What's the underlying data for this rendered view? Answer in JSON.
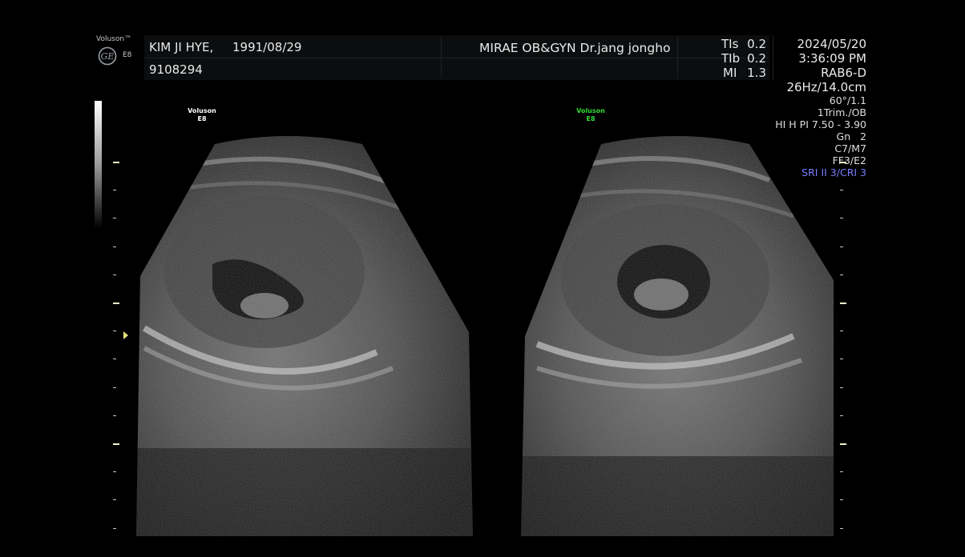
{
  "device": {
    "brand": "Voluson™",
    "model": "E8",
    "logo": "GE"
  },
  "patient": {
    "name": "KIM JI HYE,",
    "dob": "1991/08/29",
    "id": "9108294"
  },
  "clinic": "MIRAE OB&GYN Dr.jang jongho",
  "indices": {
    "tis_label": "TIs",
    "tis_value": "0.2",
    "tib_label": "TIb",
    "tib_value": "0.2",
    "mi_label": "MI",
    "mi_value": "1.3"
  },
  "datetime": {
    "date": "2024/05/20",
    "time": "3:36:09 PM"
  },
  "probe": "RAB6-D",
  "params": {
    "freq_depth": "26Hz/14.0cm",
    "angle": "60°/1.1",
    "preset": "1Trim./OB",
    "prf": "HI H PI 7.50 - 3.90",
    "gain": "Gn   2",
    "mode": "C7/M7",
    "filter": "FF3/E2",
    "sri": "SRI II 3/CRI 3"
  },
  "panes": {
    "left": {
      "brand": "Voluson",
      "model": "E8",
      "color": "#ffffff"
    },
    "right": {
      "brand": "Voluson",
      "model": "E8",
      "color": "#33dd33"
    }
  },
  "colors": {
    "sri": "#7a7cff",
    "marker": "#e6e07a",
    "ge_logo": "#9aa0a6"
  }
}
